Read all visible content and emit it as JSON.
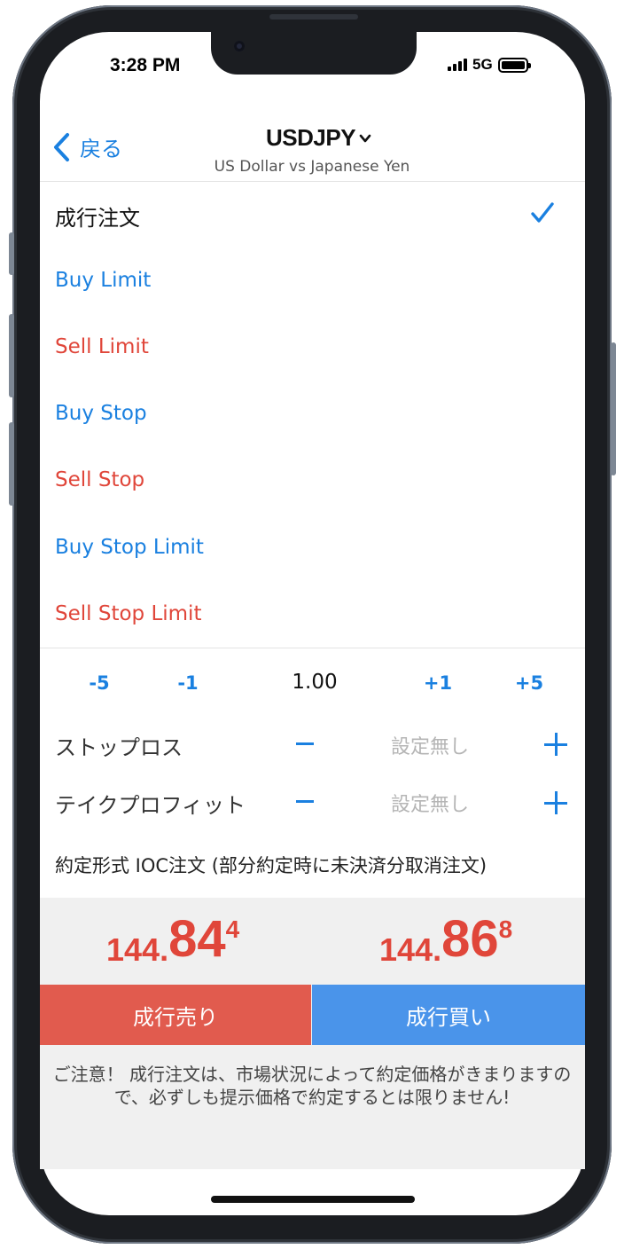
{
  "status_bar": {
    "time": "3:28 PM",
    "network": "5G"
  },
  "header": {
    "back_label": "戻る",
    "symbol": "USDJPY",
    "symbol_description": "US Dollar vs Japanese Yen"
  },
  "order_types": [
    {
      "label": "成行注文",
      "selected": true
    },
    {
      "label": "Buy Limit",
      "color": "#1a80e0"
    },
    {
      "label": "Sell Limit",
      "color": "#e0463a"
    },
    {
      "label": "Buy Stop",
      "color": "#1a80e0"
    },
    {
      "label": "Sell Stop",
      "color": "#e0463a"
    },
    {
      "label": "Buy Stop Limit",
      "color": "#1a80e0"
    },
    {
      "label": "Sell Stop Limit",
      "color": "#e0463a"
    }
  ],
  "volume": {
    "minus5": "-5",
    "minus1": "-1",
    "value": "1.00",
    "plus1": "+1",
    "plus5": "+5"
  },
  "stop_loss": {
    "label": "ストップロス",
    "value": "設定無し"
  },
  "take_profit": {
    "label": "テイクプロフィット",
    "value": "設定無し"
  },
  "fill_policy": "約定形式 IOC注文 (部分約定時に未決済分取消注文)",
  "prices": {
    "bid": {
      "prefix": "144.",
      "big": "84",
      "sup": "4"
    },
    "ask": {
      "prefix": "144.",
      "big": "86",
      "sup": "8"
    }
  },
  "actions": {
    "sell_label": "成行売り",
    "buy_label": "成行買い"
  },
  "notice": "ご注意！ 成行注文は、市場状況によって約定価格がきまりますので、必ずしも提示価格で約定するとは限りません!",
  "colors": {
    "accent": "#1a80e0",
    "sell": "#e0463a",
    "buy": "#4a94ea"
  }
}
